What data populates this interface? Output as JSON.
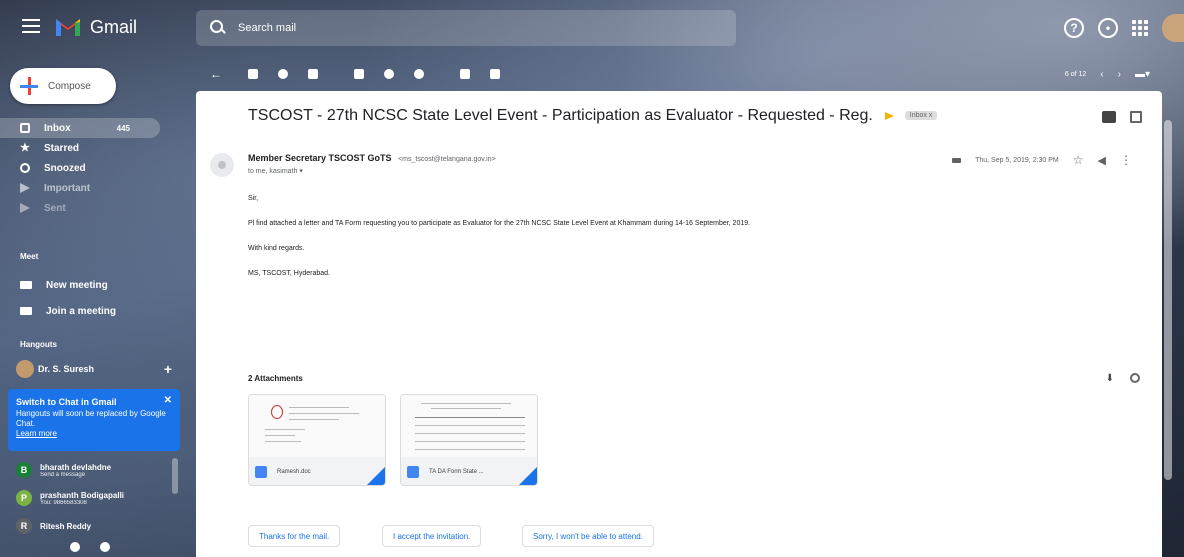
{
  "app": {
    "name": "Gmail"
  },
  "search": {
    "placeholder": "Search mail"
  },
  "compose": {
    "label": "Compose"
  },
  "nav": [
    {
      "label": "Inbox",
      "count": "445"
    },
    {
      "label": "Starred"
    },
    {
      "label": "Snoozed"
    },
    {
      "label": "Important"
    },
    {
      "label": "Sent"
    }
  ],
  "meet": {
    "section": "Meet",
    "new_meeting": "New meeting",
    "join_meeting": "Join a meeting"
  },
  "hangouts": {
    "section": "Hangouts",
    "user": "Dr. S. Suresh"
  },
  "chat_card": {
    "title": "Switch to Chat in Gmail",
    "body": "Hangouts will soon be replaced by Google Chat.",
    "link": "Learn more"
  },
  "contacts": [
    {
      "initial": "B",
      "name": "bharath devlahdne",
      "status": "Send a message",
      "color": "#188038"
    },
    {
      "initial": "P",
      "name": "prashanth Bodigapalli",
      "status": "You: 9866583308",
      "color": "#7cb342"
    },
    {
      "initial": "R",
      "name": "Ritesh Reddy",
      "status": "",
      "color": "#5f6368"
    }
  ],
  "pager": {
    "text": "6 of 12"
  },
  "email": {
    "subject": "TSCOST - 27th NCSC State Level Event - Participation as Evaluator - Requested - Reg.",
    "label": "Inbox x",
    "sender_name": "Member Secretary TSCOST GoTS",
    "sender_email": "<ms_tscost@telangana.gov.in>",
    "recipient": "to me, kasimath",
    "date": "Thu, Sep 5, 2019, 2:30 PM",
    "body": [
      "Sir,",
      "Pl find attached a letter and TA Form requesting you to participate as Evaluator for the 27th NCSC State Level Event at Khammam during 14-16 September, 2019.",
      "With kind regards.",
      "MS, TSCOST, Hyderabad."
    ],
    "attachments_title": "2 Attachments",
    "attachments": [
      {
        "name": "Ramesh.doc"
      },
      {
        "name": "TA DA Form State ..."
      }
    ],
    "smart_replies": [
      "Thanks for the mail.",
      "I accept the invitation.",
      "Sorry, I won't be able to attend."
    ]
  }
}
